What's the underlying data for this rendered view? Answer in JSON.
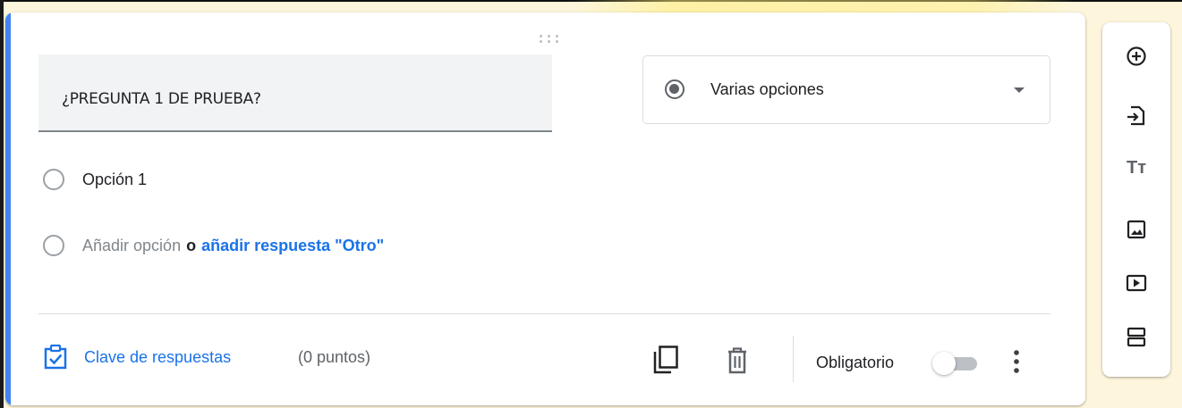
{
  "question": {
    "title": "¿PREGUNTA 1 DE PRUEBA?",
    "type_label": "Varias opciones"
  },
  "options": [
    {
      "label": "Opción 1"
    }
  ],
  "add_option": {
    "label": "Añadir opción",
    "separator": "o",
    "other_link": "añadir respuesta \"Otro\""
  },
  "footer": {
    "answer_key_label": "Clave de respuestas",
    "points": "(0 puntos)",
    "required_label": "Obligatorio",
    "required_on": false
  },
  "toolbar": {
    "items": [
      {
        "icon": "add-circle-icon"
      },
      {
        "icon": "import-icon"
      },
      {
        "icon": "title-icon",
        "glyph": "Tт"
      },
      {
        "icon": "image-icon"
      },
      {
        "icon": "video-icon"
      },
      {
        "icon": "section-icon"
      }
    ]
  },
  "colors": {
    "accent": "#4285f4",
    "link": "#1a73e8",
    "background": "#fdf6dc"
  }
}
